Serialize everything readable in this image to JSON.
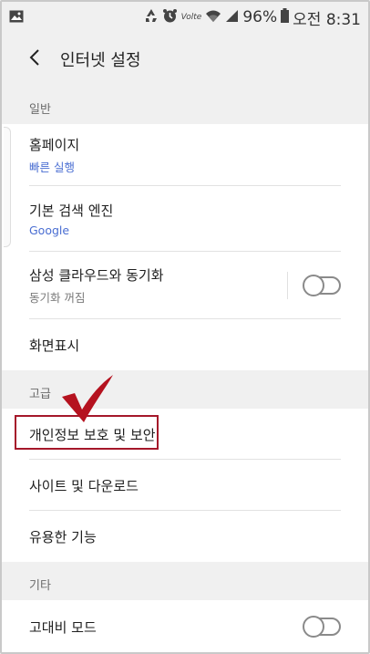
{
  "status_bar": {
    "battery": "96%",
    "time": "오전 8:31",
    "volte": "Volte",
    "icons": [
      "image-icon",
      "recycle-icon",
      "alarm-icon",
      "volte-icon",
      "wifi-icon",
      "signal-icon",
      "battery-icon"
    ]
  },
  "app_bar": {
    "title": "인터넷 설정",
    "back_icon": "back-arrow-icon"
  },
  "sections": {
    "general": {
      "header": "일반",
      "items": {
        "homepage": {
          "label": "홈페이지",
          "sub": "빠른 실행"
        },
        "search_engine": {
          "label": "기본 검색 엔진",
          "sub": "Google"
        },
        "samsung_cloud": {
          "label": "삼성 클라우드와 동기화",
          "sub": "동기화 꺼짐",
          "toggle_on": false
        },
        "display": {
          "label": "화면표시"
        }
      }
    },
    "advanced": {
      "header": "고급",
      "items": {
        "privacy": {
          "label": "개인정보 보호 및 보안",
          "highlighted": true
        },
        "sites_downloads": {
          "label": "사이트 및 다운로드"
        },
        "useful_features": {
          "label": "유용한 기능"
        }
      }
    },
    "others": {
      "header": "기타",
      "items": {
        "high_contrast": {
          "label": "고대비 모드",
          "toggle_on": false
        }
      }
    }
  },
  "colors": {
    "accent_blue": "#4a6ed2",
    "highlight_red": "#a5172a",
    "section_bg": "#f0f0f0"
  }
}
